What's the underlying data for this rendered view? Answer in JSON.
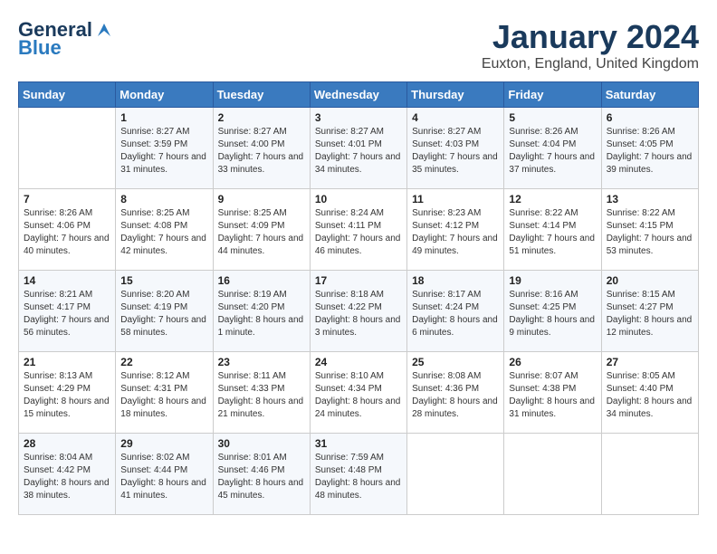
{
  "logo": {
    "line1": "General",
    "line2": "Blue"
  },
  "title": "January 2024",
  "location": "Euxton, England, United Kingdom",
  "days_of_week": [
    "Sunday",
    "Monday",
    "Tuesday",
    "Wednesday",
    "Thursday",
    "Friday",
    "Saturday"
  ],
  "weeks": [
    [
      {
        "day": "",
        "sunrise": "",
        "sunset": "",
        "daylight": ""
      },
      {
        "day": "1",
        "sunrise": "Sunrise: 8:27 AM",
        "sunset": "Sunset: 3:59 PM",
        "daylight": "Daylight: 7 hours and 31 minutes."
      },
      {
        "day": "2",
        "sunrise": "Sunrise: 8:27 AM",
        "sunset": "Sunset: 4:00 PM",
        "daylight": "Daylight: 7 hours and 33 minutes."
      },
      {
        "day": "3",
        "sunrise": "Sunrise: 8:27 AM",
        "sunset": "Sunset: 4:01 PM",
        "daylight": "Daylight: 7 hours and 34 minutes."
      },
      {
        "day": "4",
        "sunrise": "Sunrise: 8:27 AM",
        "sunset": "Sunset: 4:03 PM",
        "daylight": "Daylight: 7 hours and 35 minutes."
      },
      {
        "day": "5",
        "sunrise": "Sunrise: 8:26 AM",
        "sunset": "Sunset: 4:04 PM",
        "daylight": "Daylight: 7 hours and 37 minutes."
      },
      {
        "day": "6",
        "sunrise": "Sunrise: 8:26 AM",
        "sunset": "Sunset: 4:05 PM",
        "daylight": "Daylight: 7 hours and 39 minutes."
      }
    ],
    [
      {
        "day": "7",
        "sunrise": "Sunrise: 8:26 AM",
        "sunset": "Sunset: 4:06 PM",
        "daylight": "Daylight: 7 hours and 40 minutes."
      },
      {
        "day": "8",
        "sunrise": "Sunrise: 8:25 AM",
        "sunset": "Sunset: 4:08 PM",
        "daylight": "Daylight: 7 hours and 42 minutes."
      },
      {
        "day": "9",
        "sunrise": "Sunrise: 8:25 AM",
        "sunset": "Sunset: 4:09 PM",
        "daylight": "Daylight: 7 hours and 44 minutes."
      },
      {
        "day": "10",
        "sunrise": "Sunrise: 8:24 AM",
        "sunset": "Sunset: 4:11 PM",
        "daylight": "Daylight: 7 hours and 46 minutes."
      },
      {
        "day": "11",
        "sunrise": "Sunrise: 8:23 AM",
        "sunset": "Sunset: 4:12 PM",
        "daylight": "Daylight: 7 hours and 49 minutes."
      },
      {
        "day": "12",
        "sunrise": "Sunrise: 8:22 AM",
        "sunset": "Sunset: 4:14 PM",
        "daylight": "Daylight: 7 hours and 51 minutes."
      },
      {
        "day": "13",
        "sunrise": "Sunrise: 8:22 AM",
        "sunset": "Sunset: 4:15 PM",
        "daylight": "Daylight: 7 hours and 53 minutes."
      }
    ],
    [
      {
        "day": "14",
        "sunrise": "Sunrise: 8:21 AM",
        "sunset": "Sunset: 4:17 PM",
        "daylight": "Daylight: 7 hours and 56 minutes."
      },
      {
        "day": "15",
        "sunrise": "Sunrise: 8:20 AM",
        "sunset": "Sunset: 4:19 PM",
        "daylight": "Daylight: 7 hours and 58 minutes."
      },
      {
        "day": "16",
        "sunrise": "Sunrise: 8:19 AM",
        "sunset": "Sunset: 4:20 PM",
        "daylight": "Daylight: 8 hours and 1 minute."
      },
      {
        "day": "17",
        "sunrise": "Sunrise: 8:18 AM",
        "sunset": "Sunset: 4:22 PM",
        "daylight": "Daylight: 8 hours and 3 minutes."
      },
      {
        "day": "18",
        "sunrise": "Sunrise: 8:17 AM",
        "sunset": "Sunset: 4:24 PM",
        "daylight": "Daylight: 8 hours and 6 minutes."
      },
      {
        "day": "19",
        "sunrise": "Sunrise: 8:16 AM",
        "sunset": "Sunset: 4:25 PM",
        "daylight": "Daylight: 8 hours and 9 minutes."
      },
      {
        "day": "20",
        "sunrise": "Sunrise: 8:15 AM",
        "sunset": "Sunset: 4:27 PM",
        "daylight": "Daylight: 8 hours and 12 minutes."
      }
    ],
    [
      {
        "day": "21",
        "sunrise": "Sunrise: 8:13 AM",
        "sunset": "Sunset: 4:29 PM",
        "daylight": "Daylight: 8 hours and 15 minutes."
      },
      {
        "day": "22",
        "sunrise": "Sunrise: 8:12 AM",
        "sunset": "Sunset: 4:31 PM",
        "daylight": "Daylight: 8 hours and 18 minutes."
      },
      {
        "day": "23",
        "sunrise": "Sunrise: 8:11 AM",
        "sunset": "Sunset: 4:33 PM",
        "daylight": "Daylight: 8 hours and 21 minutes."
      },
      {
        "day": "24",
        "sunrise": "Sunrise: 8:10 AM",
        "sunset": "Sunset: 4:34 PM",
        "daylight": "Daylight: 8 hours and 24 minutes."
      },
      {
        "day": "25",
        "sunrise": "Sunrise: 8:08 AM",
        "sunset": "Sunset: 4:36 PM",
        "daylight": "Daylight: 8 hours and 28 minutes."
      },
      {
        "day": "26",
        "sunrise": "Sunrise: 8:07 AM",
        "sunset": "Sunset: 4:38 PM",
        "daylight": "Daylight: 8 hours and 31 minutes."
      },
      {
        "day": "27",
        "sunrise": "Sunrise: 8:05 AM",
        "sunset": "Sunset: 4:40 PM",
        "daylight": "Daylight: 8 hours and 34 minutes."
      }
    ],
    [
      {
        "day": "28",
        "sunrise": "Sunrise: 8:04 AM",
        "sunset": "Sunset: 4:42 PM",
        "daylight": "Daylight: 8 hours and 38 minutes."
      },
      {
        "day": "29",
        "sunrise": "Sunrise: 8:02 AM",
        "sunset": "Sunset: 4:44 PM",
        "daylight": "Daylight: 8 hours and 41 minutes."
      },
      {
        "day": "30",
        "sunrise": "Sunrise: 8:01 AM",
        "sunset": "Sunset: 4:46 PM",
        "daylight": "Daylight: 8 hours and 45 minutes."
      },
      {
        "day": "31",
        "sunrise": "Sunrise: 7:59 AM",
        "sunset": "Sunset: 4:48 PM",
        "daylight": "Daylight: 8 hours and 48 minutes."
      },
      {
        "day": "",
        "sunrise": "",
        "sunset": "",
        "daylight": ""
      },
      {
        "day": "",
        "sunrise": "",
        "sunset": "",
        "daylight": ""
      },
      {
        "day": "",
        "sunrise": "",
        "sunset": "",
        "daylight": ""
      }
    ]
  ]
}
